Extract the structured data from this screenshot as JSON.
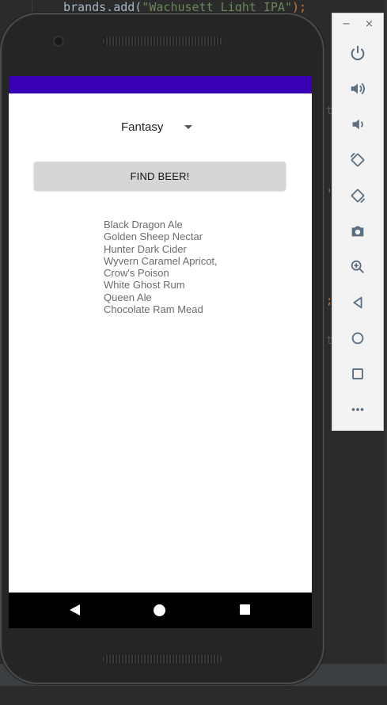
{
  "ide": {
    "code_prefix": "brands.add(",
    "code_string": "\"Wachusett Light IPA\"",
    "code_suffix": ");"
  },
  "app": {
    "spinner_selected": "Fantasy",
    "find_button_label": "FIND BEER!",
    "beers": [
      "Black Dragon Ale",
      "Golden Sheep Nectar",
      "Hunter Dark Cider",
      "Wyvern Caramel Apricot,",
      "Crow's Poison",
      "White Ghost Rum",
      "Queen Ale",
      "Chocolate Ram Mead"
    ],
    "colors": {
      "status_bar": "#3700b3",
      "button": "#d6d6d6",
      "list_text": "#6b6b6b"
    }
  },
  "emulator_toolbar": {
    "minimize_glyph": "−",
    "close_glyph": "×",
    "icons": [
      "power-icon",
      "volume-up-icon",
      "volume-down-icon",
      "rotate-left-icon",
      "rotate-right-icon",
      "camera-icon",
      "zoom-icon",
      "back-icon",
      "home-icon",
      "overview-icon",
      "more-icon"
    ]
  },
  "nav_bar": {
    "icons": [
      "back-icon",
      "home-icon",
      "recents-icon"
    ]
  }
}
